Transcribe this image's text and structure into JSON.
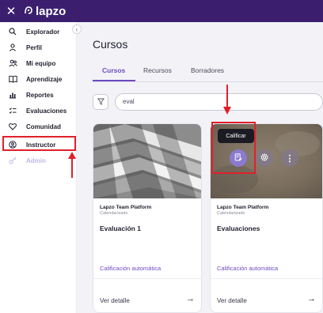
{
  "topbar": {
    "close_icon": "close-icon",
    "logo_text": "lapzo"
  },
  "sidebar": {
    "collapse_icon": "chevron-left-icon",
    "items": [
      {
        "label": "Explorador",
        "icon": "search-icon"
      },
      {
        "label": "Perfil",
        "icon": "user-icon"
      },
      {
        "label": "Mi equipo",
        "icon": "team-icon"
      },
      {
        "label": "Aprendizaje",
        "icon": "book-icon"
      },
      {
        "label": "Reportes",
        "icon": "chart-icon"
      },
      {
        "label": "Evaluaciones",
        "icon": "checklist-icon"
      },
      {
        "label": "Comunidad",
        "icon": "heart-icon"
      },
      {
        "label": "Instructor",
        "icon": "instructor-icon"
      },
      {
        "label": "Admin",
        "icon": "key-icon"
      }
    ]
  },
  "main": {
    "title": "Cursos",
    "tabs": [
      {
        "label": "Cursos"
      },
      {
        "label": "Recursos"
      },
      {
        "label": "Borradores"
      }
    ],
    "search": {
      "value": "eval"
    }
  },
  "cards": [
    {
      "org": "Lapzo Team Platform",
      "status": "Calendarizado",
      "title": "Evaluación 1",
      "grading": "Calificación automática",
      "detail": "Ver detalle"
    },
    {
      "org": "Lapzo Team Platform",
      "status": "Calendarizado",
      "title": "Evaluaciones",
      "grading": "Calificación automática",
      "detail": "Ver detalle",
      "tooltip": "Calificar"
    }
  ],
  "colors": {
    "topbar": "#3b1f6e",
    "accent": "#6d4bc2",
    "annotation": "#e0202a"
  }
}
